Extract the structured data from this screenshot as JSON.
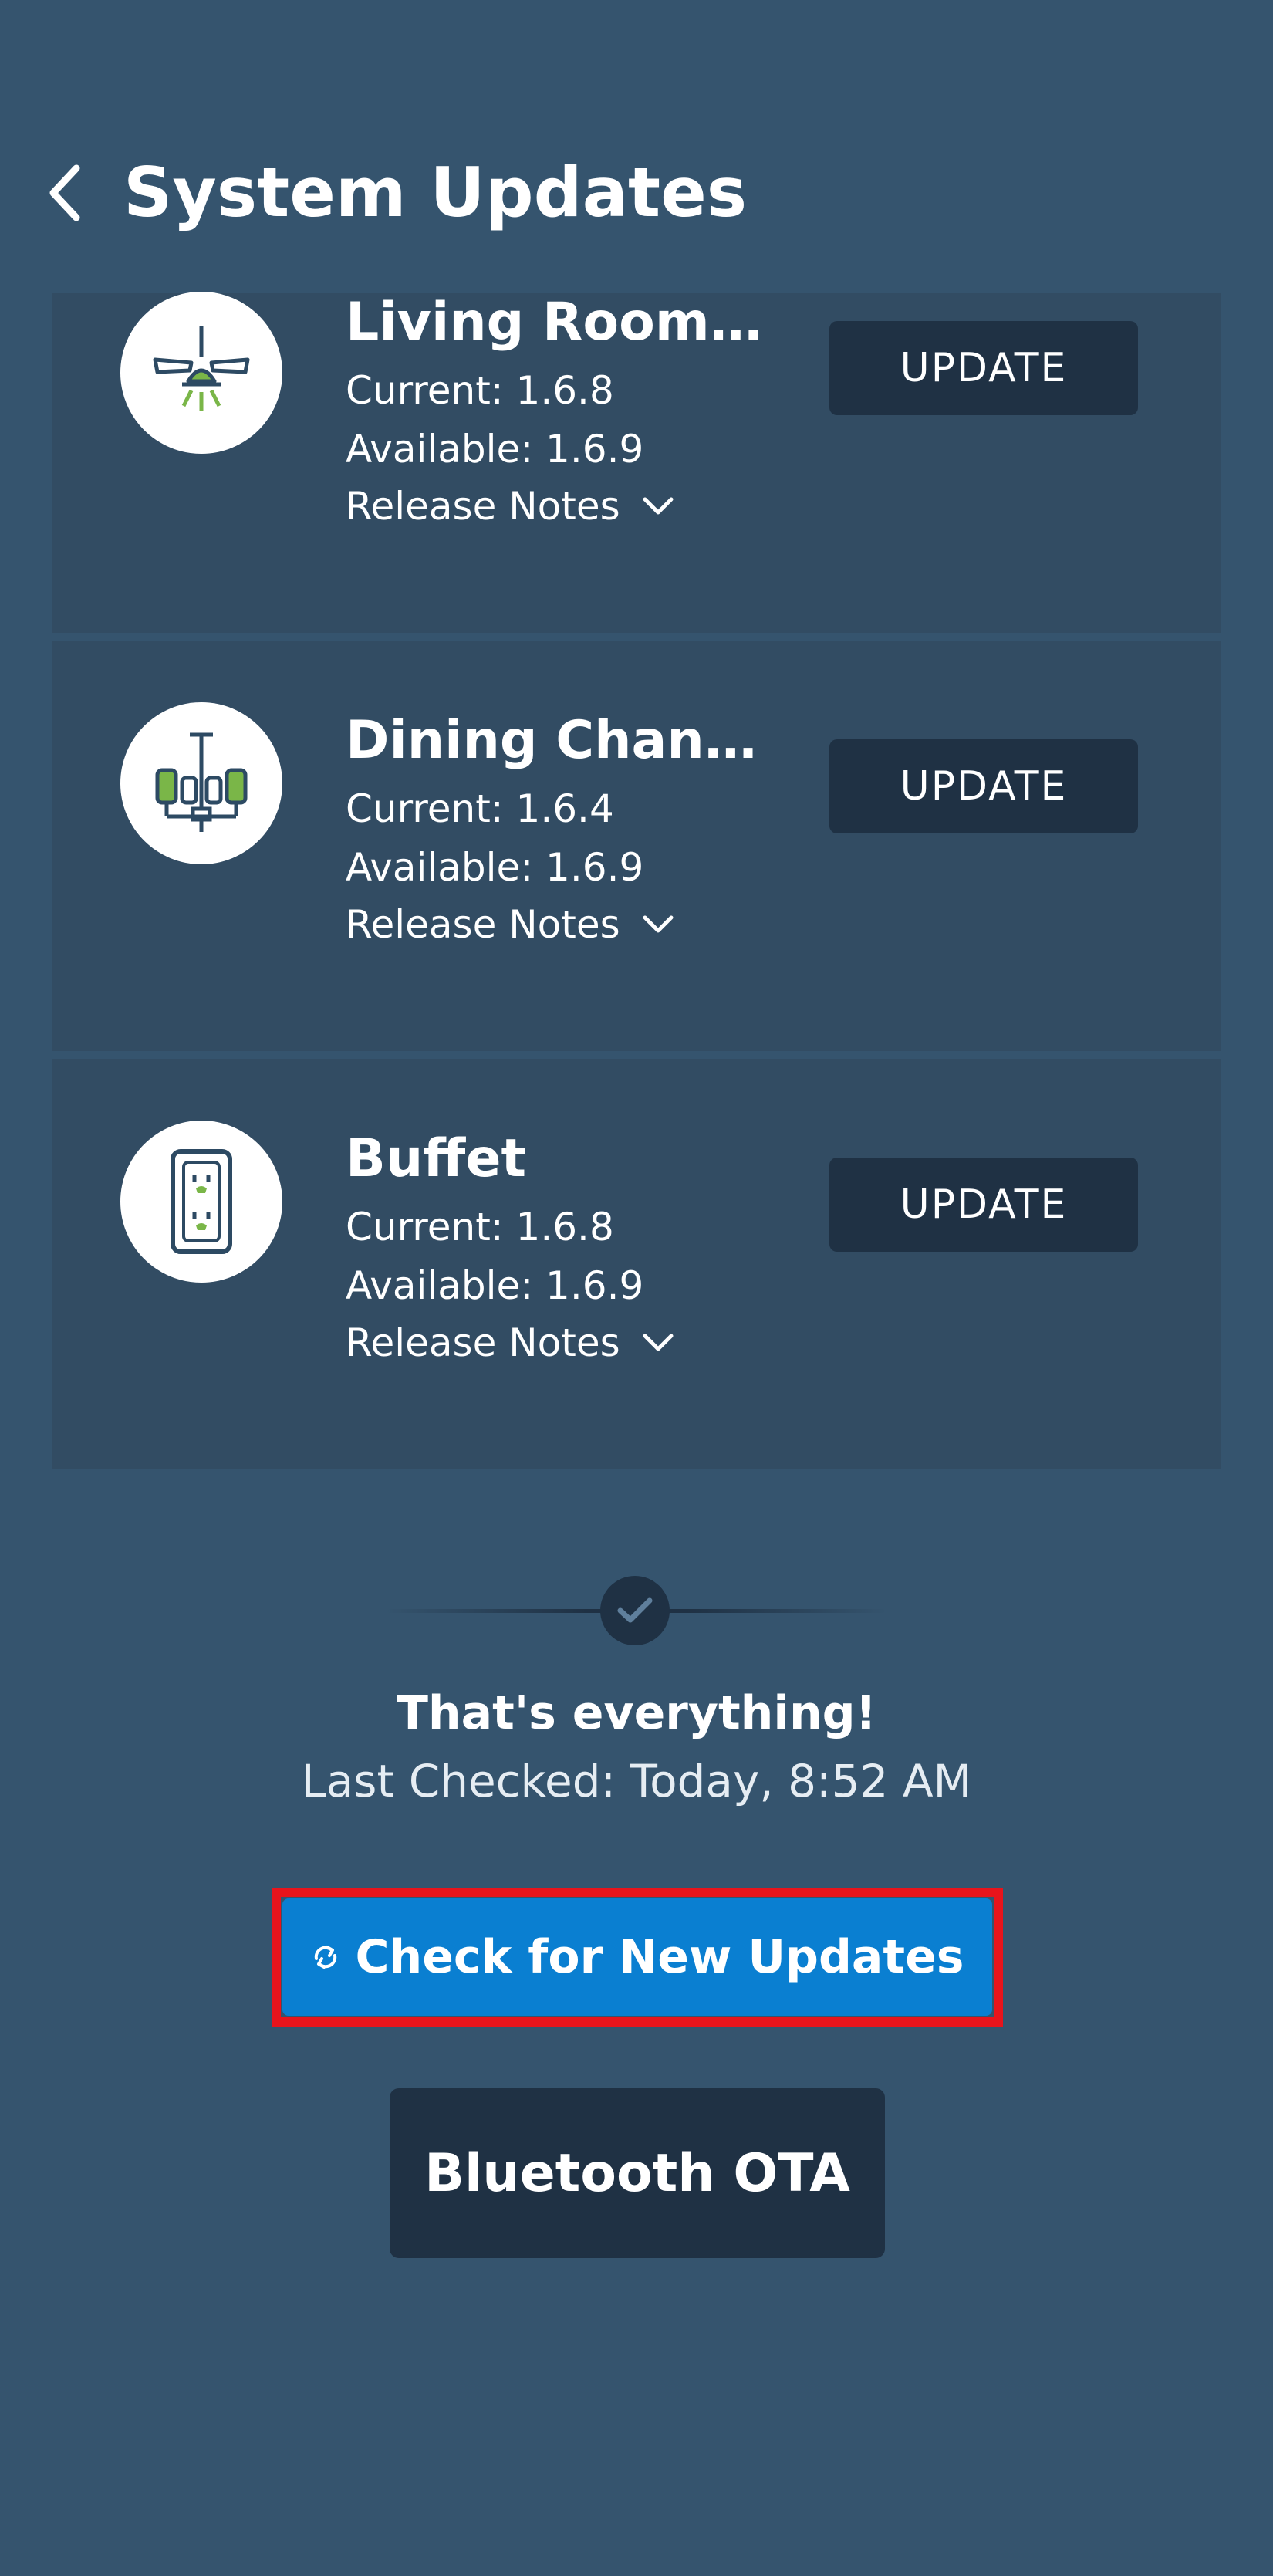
{
  "header": {
    "title": "System Updates"
  },
  "devices": [
    {
      "name": "Living Room F...",
      "current": "Current: 1.6.8",
      "available": "Available: 1.6.9",
      "release_notes": "Release Notes",
      "update_label": "UPDATE",
      "icon": "ceiling-fan-icon"
    },
    {
      "name": "Dining Chand...",
      "current": "Current: 1.6.4",
      "available": "Available: 1.6.9",
      "release_notes": "Release Notes",
      "update_label": "UPDATE",
      "icon": "chandelier-icon"
    },
    {
      "name": "Buffet",
      "current": "Current: 1.6.8",
      "available": "Available: 1.6.9",
      "release_notes": "Release Notes",
      "update_label": "UPDATE",
      "icon": "outlet-icon"
    }
  ],
  "status": {
    "done_title": "That's everything!",
    "last_checked": "Last Checked: Today, 8:52 AM"
  },
  "actions": {
    "check_updates_label": "Check for New Updates",
    "bluetooth_ota_label": "Bluetooth OTA"
  },
  "colors": {
    "background": "#35546e",
    "card": "#324c63",
    "dark_button": "#1f3144",
    "primary_button": "#0a7fd1",
    "highlight": "#e8141c",
    "icon_green": "#7ab648"
  }
}
